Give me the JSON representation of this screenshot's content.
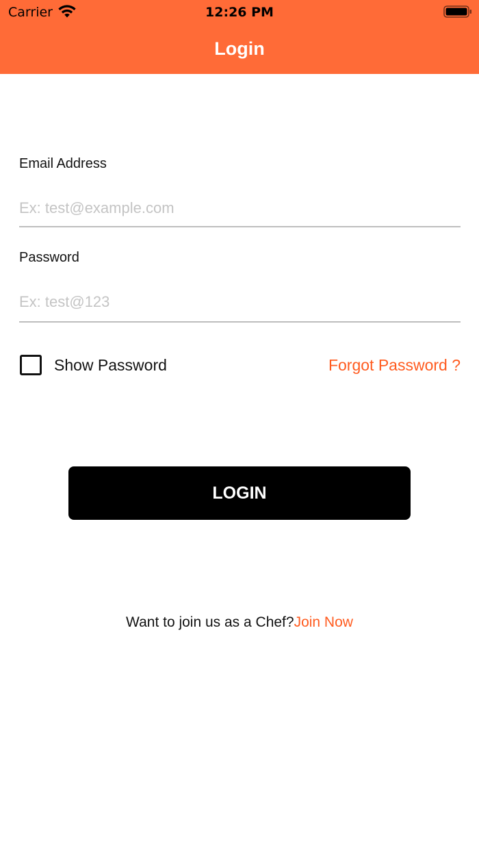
{
  "status_bar": {
    "carrier": "Carrier",
    "time": "12:26 PM",
    "wifi_icon": "wifi-icon",
    "battery_icon": "battery-icon"
  },
  "nav": {
    "title": "Login",
    "background_color": "#FF6B37"
  },
  "form": {
    "email": {
      "label": "Email Address",
      "value": "",
      "placeholder": "Ex: test@example.com"
    },
    "password": {
      "label": "Password",
      "value": "",
      "placeholder": "Ex: test@123"
    },
    "show_password": {
      "label": "Show Password",
      "checked": false
    },
    "forgot_password": "Forgot Password ?",
    "login_button": "LOGIN"
  },
  "footer": {
    "prompt": "Want to join us as a Chef?",
    "link": "Join Now"
  },
  "colors": {
    "accent": "#FF5B1F",
    "button": "#000000"
  }
}
